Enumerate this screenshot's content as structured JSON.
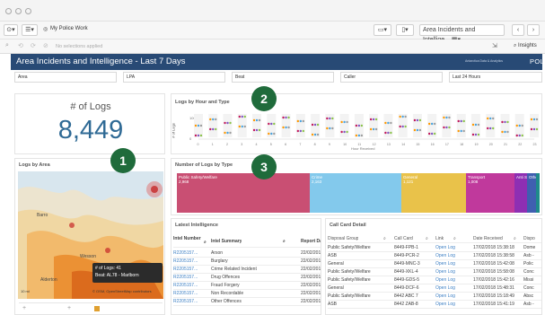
{
  "toolbar": {
    "app_name": "My Police Work",
    "sheet_selector": "Area Incidents and Intellige...",
    "selections": "No selections applied",
    "insights": "Insights"
  },
  "header": {
    "title": "Area Incidents and Intelligence - Last 7 Days",
    "sub_brand": "Antarctica Data & Analytics",
    "brand": "POLICE"
  },
  "filters": [
    "Area",
    "LPA",
    "Beat",
    "Caller",
    "Last 24 Hours"
  ],
  "kpi": {
    "title": "# of Logs",
    "value": "8,449"
  },
  "badges": [
    "1",
    "2",
    "3"
  ],
  "logs_by_hour": {
    "title": "Logs by Hour and Type",
    "ylabel": "# of Logs",
    "y_ticks": [
      "100",
      "0"
    ],
    "xlabel": "Hour Received",
    "x_ticks": [
      "0",
      "1",
      "2",
      "3",
      "4",
      "5",
      "6",
      "7",
      "8",
      "9",
      "10",
      "11",
      "12",
      "13",
      "14",
      "15",
      "16",
      "17",
      "18",
      "19",
      "20",
      "21",
      "22",
      "23"
    ],
    "colors": [
      "#c2185b",
      "#4aa3df",
      "#8bc34a",
      "#ff9800",
      "#7e57c2",
      "#9e9e9e"
    ]
  },
  "logs_by_area": {
    "title": "Logs by Area",
    "places": [
      "Barro",
      "Wesson",
      "Alderton"
    ],
    "tooltip_line1": "# of Logs: 41",
    "tooltip_line2": "Beat: AL78 - Marlborn",
    "attribution": "© OSM, OpenStreetMap contributors",
    "scale": "10 mi"
  },
  "logs_by_type": {
    "title": "Number of Logs by Type",
    "segments": [
      {
        "label": "Public Safety/Welfare",
        "value": "2,968",
        "color": "#c94f73"
      },
      {
        "label": "Crime",
        "value": "2,163",
        "color": "#83c9ec"
      },
      {
        "label": "General",
        "value": "1,121",
        "color": "#e9c24a"
      },
      {
        "label": "Transport",
        "value": "1,008",
        "color": "#c0399c"
      },
      {
        "label": "Anti Social",
        "value": "",
        "color": "#8e2fb3"
      },
      {
        "label": "Other",
        "value": "",
        "color": "#3f5fb0"
      },
      {
        "label": "",
        "value": "",
        "color": "#1e8a8a"
      }
    ]
  },
  "latest_intel": {
    "title": "Latest Intelligence",
    "columns": [
      "Intel Number",
      "Intel Summary",
      "Report Da"
    ],
    "rows": [
      [
        "R2205157...",
        "Arson",
        "22/02/201"
      ],
      [
        "R2205157...",
        "Burglary",
        "22/02/201"
      ],
      [
        "R2205157...",
        "Crime Related Incident",
        "22/02/201"
      ],
      [
        "R2205157...",
        "Drug Offences",
        "22/02/201"
      ],
      [
        "R2205157...",
        "Fraud Forgery",
        "22/02/201"
      ],
      [
        "R2205157...",
        "Non Recordable",
        "22/02/201"
      ],
      [
        "R2205157...",
        "Other Offences",
        "22/02/201"
      ]
    ]
  },
  "call_card": {
    "title": "Call Card Detail",
    "columns": [
      "Disposal Group",
      "Call Card",
      "Link",
      "Date Received",
      "Dispo"
    ],
    "rows": [
      [
        "Public Safety/Welfare",
        "8449-FPB-1",
        "Open Log",
        "17/02/2018 15:38:18",
        "Dome"
      ],
      [
        "ASB",
        "8449-PCR-2",
        "Open Log",
        "17/02/2018 15:38:58",
        "Asb -"
      ],
      [
        "General",
        "8449-MNC-3",
        "Open Log",
        "17/02/2018 15:42:08",
        "Polic"
      ],
      [
        "Public Safety/Welfare",
        "8449-XKL-4",
        "Open Log",
        "17/02/2018 15:58:08",
        "Conc"
      ],
      [
        "Public Safety/Welfare",
        "8449-GDS-5",
        "Open Log",
        "17/02/2018 15:42:16",
        "Missi"
      ],
      [
        "General",
        "8449-DCF-6",
        "Open Log",
        "17/02/2018 15:48:31",
        "Conc"
      ],
      [
        "Public Safety/Welfare",
        "8442 ABC 7",
        "Open Log",
        "17/02/2018 15:18:49",
        "Absc"
      ],
      [
        "ASB",
        "8442 ZAB-8",
        "Open Log",
        "17/02/2018 15:41:19",
        "Asb -"
      ]
    ]
  }
}
